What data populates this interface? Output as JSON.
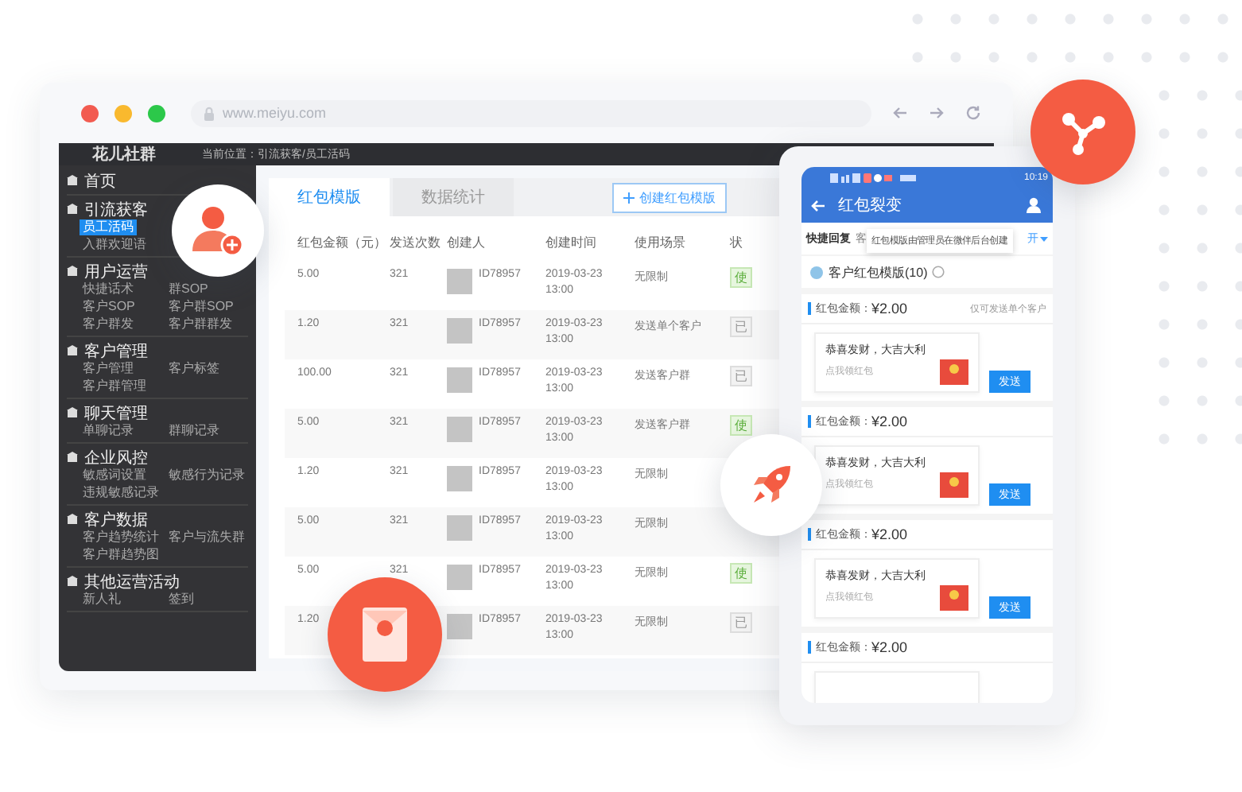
{
  "browser": {
    "url": "www.meiyu.com"
  },
  "app": {
    "brand": "花儿社群",
    "breadcrumb": "当前位置：引流获客/员工活码",
    "sidebar": [
      {
        "label": "首页"
      },
      {
        "label": "引流获客",
        "kind": "stack",
        "children": [
          {
            "label": "员工活码",
            "selected": true
          },
          {
            "label": "入群欢迎语",
            "selected": false
          }
        ]
      },
      {
        "label": "用户运营",
        "kind": "grid",
        "children": [
          {
            "label": "快捷话术",
            "selected": false
          },
          {
            "label": "群SOP",
            "selected": false
          },
          {
            "label": "客户SOP",
            "selected": false
          },
          {
            "label": "客户群SOP",
            "selected": false
          },
          {
            "label": "客户群发",
            "selected": false
          },
          {
            "label": "客户群群发",
            "selected": false
          }
        ]
      },
      {
        "label": "客户管理",
        "kind": "grid",
        "children": [
          {
            "label": "客户管理",
            "selected": false
          },
          {
            "label": "客户标签",
            "selected": false
          },
          {
            "label": "客户群管理",
            "selected": false
          }
        ]
      },
      {
        "label": "聊天管理",
        "kind": "grid",
        "children": [
          {
            "label": "单聊记录",
            "selected": false
          },
          {
            "label": "群聊记录",
            "selected": false
          }
        ]
      },
      {
        "label": "企业风控",
        "kind": "grid",
        "children": [
          {
            "label": "敏感词设置",
            "selected": false
          },
          {
            "label": "敏感行为记录",
            "selected": false
          },
          {
            "label": "违规敏感记录",
            "selected": false
          }
        ]
      },
      {
        "label": "客户数据",
        "kind": "grid",
        "children": [
          {
            "label": "客户趋势统计",
            "selected": false
          },
          {
            "label": "客户与流失群",
            "selected": false
          },
          {
            "label": "客户群趋势图",
            "selected": false
          }
        ]
      },
      {
        "label": "其他运营活动",
        "kind": "grid",
        "children": [
          {
            "label": "新人礼",
            "selected": false
          },
          {
            "label": "签到",
            "selected": false
          }
        ]
      }
    ],
    "tabs": [
      {
        "label": "红包模版",
        "selected": true
      },
      {
        "label": "数据统计",
        "selected": false
      }
    ],
    "create_button": "创建红包模版",
    "table": {
      "columns": [
        "红包金额（元）",
        "发送次数",
        "创建人",
        "创建时间",
        "使用场景",
        "状"
      ],
      "rows": [
        {
          "amount": "5.00",
          "count": "321",
          "creator": "ID78957",
          "date": "2019-03-23",
          "time": "13:00",
          "scene": "无限制",
          "status": {
            "label": "使",
            "kind": "active"
          }
        },
        {
          "amount": "1.20",
          "count": "321",
          "creator": "ID78957",
          "date": "2019-03-23",
          "time": "13:00",
          "scene": "发送单个客户",
          "status": {
            "label": "已",
            "kind": "inactive"
          }
        },
        {
          "amount": "100.00",
          "count": "321",
          "creator": "ID78957",
          "date": "2019-03-23",
          "time": "13:00",
          "scene": "发送客户群",
          "status": {
            "label": "已",
            "kind": "inactive"
          }
        },
        {
          "amount": "5.00",
          "count": "321",
          "creator": "ID78957",
          "date": "2019-03-23",
          "time": "13:00",
          "scene": "发送客户群",
          "status": {
            "label": "使",
            "kind": "active"
          }
        },
        {
          "amount": "1.20",
          "count": "321",
          "creator": "ID78957",
          "date": "2019-03-23",
          "time": "13:00",
          "scene": "无限制"
        },
        {
          "amount": "5.00",
          "count": "321",
          "creator": "ID78957",
          "date": "2019-03-23",
          "time": "13:00",
          "scene": "无限制"
        },
        {
          "amount": "5.00",
          "count": "321",
          "creator": "ID78957",
          "date": "2019-03-23",
          "time": "13:00",
          "scene": "无限制",
          "status": {
            "label": "使",
            "kind": "active"
          }
        },
        {
          "amount": "1.20",
          "creator": "ID78957",
          "date": "2019-03-23",
          "time": "13:00",
          "scene": "无限制",
          "status": {
            "label": "已",
            "kind": "inactive"
          }
        }
      ]
    }
  },
  "phone": {
    "clock": "10:19",
    "title": "红包裂变",
    "tabs": [
      {
        "label": "快捷回复",
        "selected": true
      },
      {
        "label": "客",
        "selected": false
      }
    ],
    "tab_more": "开",
    "tooltip": "红包模版由管理员在微伴后台创建",
    "section_title": "客户红包模版(10)",
    "templates": [
      {
        "amount_label": "红包金额：",
        "amount": "¥2.00",
        "note": "仅可发送单个客户",
        "card_title": "恭喜发财，大吉大利",
        "card_subtitle": "点我领红包",
        "button": "发送"
      },
      {
        "amount_label": "红包金额：",
        "amount": "¥2.00",
        "card_title": "恭喜发财，大吉大利",
        "card_subtitle": "点我领红包",
        "button": "发送"
      },
      {
        "amount_label": "红包金额：",
        "amount": "¥2.00",
        "card_title": "恭喜发财，大吉大利",
        "card_subtitle": "点我领红包",
        "button": "发送"
      },
      {
        "amount_label": "红包金额：",
        "amount": "¥2.00"
      }
    ]
  }
}
